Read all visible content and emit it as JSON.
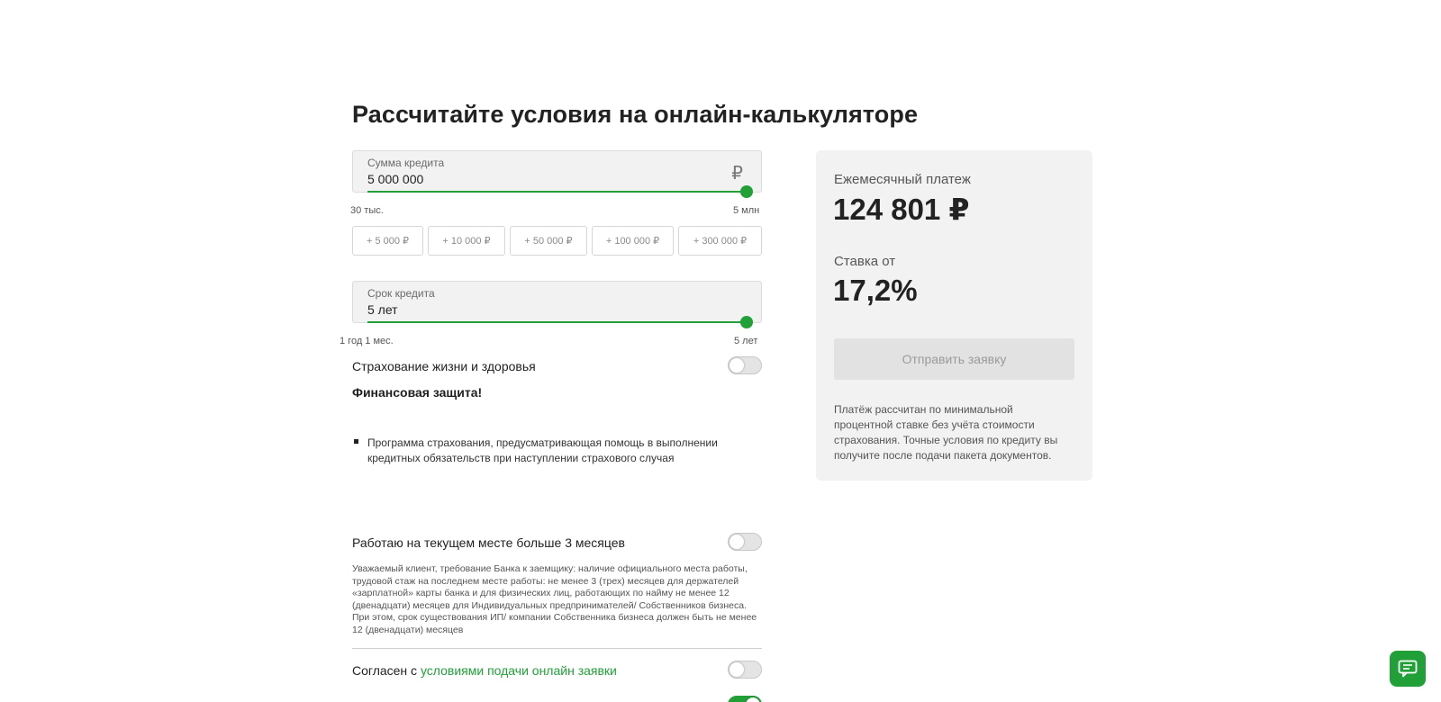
{
  "title": "Рассчитайте условия на онлайн-калькуляторе",
  "loan_amount": {
    "label": "Сумма кредита",
    "value": "5 000 000",
    "currency_symbol": "₽",
    "min_label": "30 тыс.",
    "max_label": "5 млн",
    "slider_fraction": 1.0
  },
  "quick_add": [
    "+ 5 000 ₽",
    "+ 10 000 ₽",
    "+ 50 000 ₽",
    "+ 100 000 ₽",
    "+ 300 000 ₽"
  ],
  "loan_term": {
    "label": "Срок кредита",
    "value": "5 лет",
    "min_label": "1 год 1 мес.",
    "max_label": "5 лет",
    "slider_fraction": 1.0
  },
  "insurance": {
    "label": "Страхование жизни и здоровья",
    "enabled": false,
    "heading": "Финансовая защита!",
    "bullet": "Программа страхования, предусматривающая помощь в выполнении кредитных обязательств при наступлении страхового случая"
  },
  "employment": {
    "label": "Работаю на текущем месте больше 3 месяцев",
    "enabled": false,
    "notice": "Уважаемый клиент, требование Банка к заемщику: наличие официального места работы, трудовой стаж на последнем месте работы: не менее 3 (трех) месяцев для держателей «зарплатной» карты банка и для физических лиц, работающих по найму не менее 12 (двенадцати) месяцев для Индивидуальных предпринимателей/ Собственников бизнеса. При этом, срок существования ИП/ компании Собственника бизнеса должен быть не менее 12 (двенадцати) месяцев"
  },
  "agreement": {
    "prefix": "Согласен с ",
    "link_text": "условиями подачи онлайн заявки",
    "enabled": false
  },
  "result": {
    "monthly_label": "Ежемесячный платеж",
    "monthly_value": "124 801 ₽",
    "rate_label": "Ставка от",
    "rate_value": "17,2%",
    "submit_label": "Отправить заявку",
    "note": "Платёж рассчитан по минимальной процентной ставке без учёта стоимости страхования. Точные условия по кредиту вы получите после подачи пакета документов."
  },
  "colors": {
    "accent": "#21a038",
    "panel_bg": "#f2f2f2"
  },
  "icons": {
    "chat": "chat-icon"
  }
}
